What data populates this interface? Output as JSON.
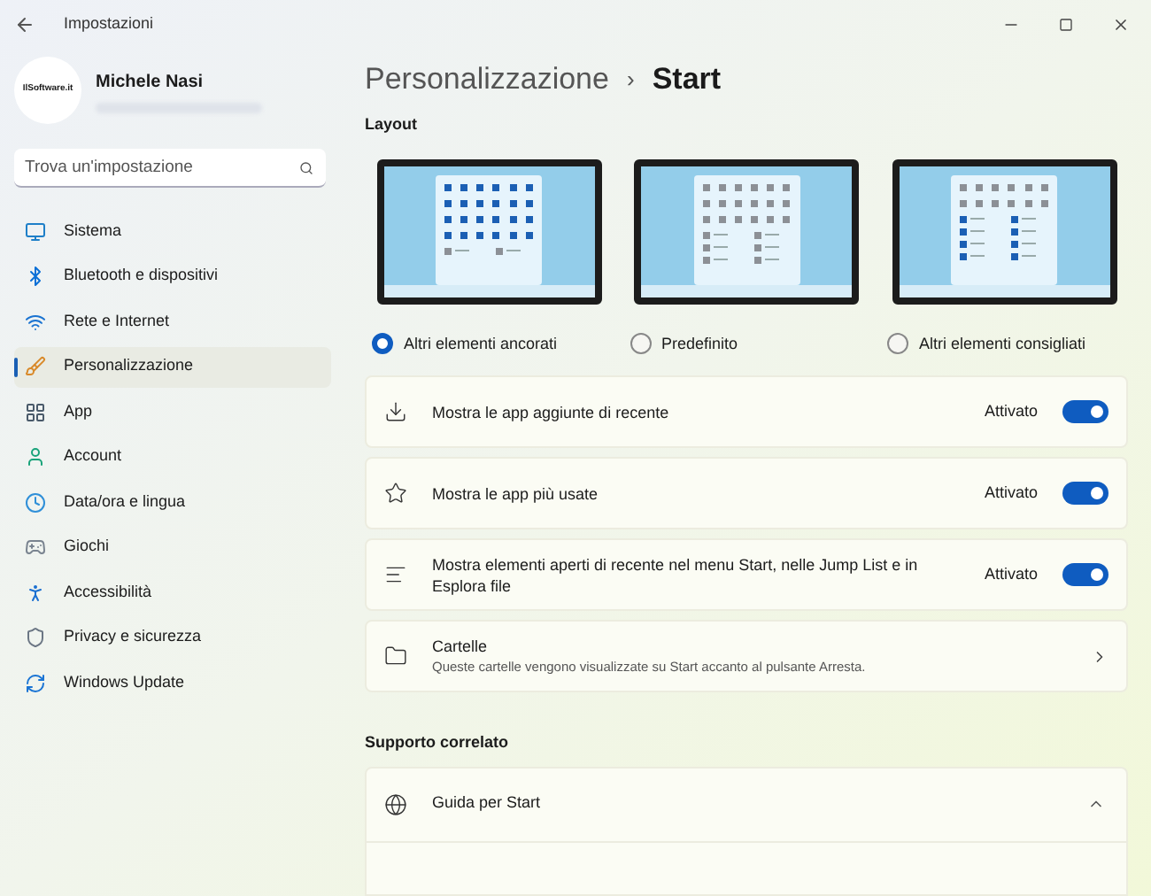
{
  "window": {
    "title": "Impostazioni"
  },
  "user": {
    "name": "Michele Nasi",
    "avatar_text": "IlSoftware.it"
  },
  "search": {
    "placeholder": "Trova un'impostazione"
  },
  "sidebar": {
    "items": [
      {
        "label": "Sistema",
        "selected": false
      },
      {
        "label": "Bluetooth e dispositivi",
        "selected": false
      },
      {
        "label": "Rete e Internet",
        "selected": false
      },
      {
        "label": "Personalizzazione",
        "selected": true
      },
      {
        "label": "App",
        "selected": false
      },
      {
        "label": "Account",
        "selected": false
      },
      {
        "label": "Data/ora e lingua",
        "selected": false
      },
      {
        "label": "Giochi",
        "selected": false
      },
      {
        "label": "Accessibilità",
        "selected": false
      },
      {
        "label": "Privacy e sicurezza",
        "selected": false
      },
      {
        "label": "Windows Update",
        "selected": false
      }
    ]
  },
  "breadcrumb": {
    "parent": "Personalizzazione",
    "separator": "›",
    "current": "Start"
  },
  "layout": {
    "heading": "Layout",
    "options": [
      {
        "label": "Altri elementi ancorati",
        "kind": "pinned",
        "selected": true
      },
      {
        "label": "Predefinito",
        "kind": "default",
        "selected": false
      },
      {
        "label": "Altri elementi consigliati",
        "kind": "recommended",
        "selected": false
      }
    ]
  },
  "settings": [
    {
      "kind": "toggle",
      "label": "Mostra le app aggiunte di recente",
      "state_text": "Attivato",
      "on": true
    },
    {
      "kind": "toggle",
      "label": "Mostra le app più usate",
      "state_text": "Attivato",
      "on": true
    },
    {
      "kind": "toggle",
      "label": "Mostra elementi aperti di recente nel menu Start, nelle Jump List e in Esplora file",
      "state_text": "Attivato",
      "on": true
    },
    {
      "kind": "link",
      "label": "Cartelle",
      "description": "Queste cartelle vengono visualizzate su Start accanto al pulsante Arresta."
    }
  ],
  "related": {
    "heading": "Supporto correlato",
    "items": [
      {
        "label": "Guida per Start",
        "expanded": true
      }
    ]
  }
}
